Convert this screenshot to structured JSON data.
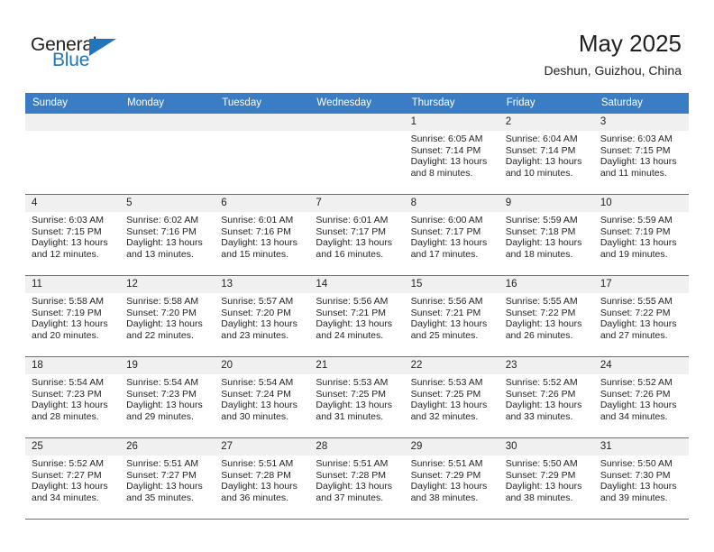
{
  "brand": {
    "name_part1": "General",
    "name_part2": "Blue",
    "accent_color": "#2175bc"
  },
  "header": {
    "month_title": "May 2025",
    "location": "Deshun, Guizhou, China"
  },
  "theme": {
    "header_row_color": "#3b7dc4",
    "daynum_band_color": "#f0f0f0",
    "text_color": "#231f20"
  },
  "weekday_headers": [
    "Sunday",
    "Monday",
    "Tuesday",
    "Wednesday",
    "Thursday",
    "Friday",
    "Saturday"
  ],
  "weeks": [
    [
      {
        "day": "",
        "sunrise": "",
        "sunset": "",
        "daylight_line1": "",
        "daylight_line2": ""
      },
      {
        "day": "",
        "sunrise": "",
        "sunset": "",
        "daylight_line1": "",
        "daylight_line2": ""
      },
      {
        "day": "",
        "sunrise": "",
        "sunset": "",
        "daylight_line1": "",
        "daylight_line2": ""
      },
      {
        "day": "",
        "sunrise": "",
        "sunset": "",
        "daylight_line1": "",
        "daylight_line2": ""
      },
      {
        "day": "1",
        "sunrise": "Sunrise: 6:05 AM",
        "sunset": "Sunset: 7:14 PM",
        "daylight_line1": "Daylight: 13 hours",
        "daylight_line2": "and 8 minutes."
      },
      {
        "day": "2",
        "sunrise": "Sunrise: 6:04 AM",
        "sunset": "Sunset: 7:14 PM",
        "daylight_line1": "Daylight: 13 hours",
        "daylight_line2": "and 10 minutes."
      },
      {
        "day": "3",
        "sunrise": "Sunrise: 6:03 AM",
        "sunset": "Sunset: 7:15 PM",
        "daylight_line1": "Daylight: 13 hours",
        "daylight_line2": "and 11 minutes."
      }
    ],
    [
      {
        "day": "4",
        "sunrise": "Sunrise: 6:03 AM",
        "sunset": "Sunset: 7:15 PM",
        "daylight_line1": "Daylight: 13 hours",
        "daylight_line2": "and 12 minutes."
      },
      {
        "day": "5",
        "sunrise": "Sunrise: 6:02 AM",
        "sunset": "Sunset: 7:16 PM",
        "daylight_line1": "Daylight: 13 hours",
        "daylight_line2": "and 13 minutes."
      },
      {
        "day": "6",
        "sunrise": "Sunrise: 6:01 AM",
        "sunset": "Sunset: 7:16 PM",
        "daylight_line1": "Daylight: 13 hours",
        "daylight_line2": "and 15 minutes."
      },
      {
        "day": "7",
        "sunrise": "Sunrise: 6:01 AM",
        "sunset": "Sunset: 7:17 PM",
        "daylight_line1": "Daylight: 13 hours",
        "daylight_line2": "and 16 minutes."
      },
      {
        "day": "8",
        "sunrise": "Sunrise: 6:00 AM",
        "sunset": "Sunset: 7:17 PM",
        "daylight_line1": "Daylight: 13 hours",
        "daylight_line2": "and 17 minutes."
      },
      {
        "day": "9",
        "sunrise": "Sunrise: 5:59 AM",
        "sunset": "Sunset: 7:18 PM",
        "daylight_line1": "Daylight: 13 hours",
        "daylight_line2": "and 18 minutes."
      },
      {
        "day": "10",
        "sunrise": "Sunrise: 5:59 AM",
        "sunset": "Sunset: 7:19 PM",
        "daylight_line1": "Daylight: 13 hours",
        "daylight_line2": "and 19 minutes."
      }
    ],
    [
      {
        "day": "11",
        "sunrise": "Sunrise: 5:58 AM",
        "sunset": "Sunset: 7:19 PM",
        "daylight_line1": "Daylight: 13 hours",
        "daylight_line2": "and 20 minutes."
      },
      {
        "day": "12",
        "sunrise": "Sunrise: 5:58 AM",
        "sunset": "Sunset: 7:20 PM",
        "daylight_line1": "Daylight: 13 hours",
        "daylight_line2": "and 22 minutes."
      },
      {
        "day": "13",
        "sunrise": "Sunrise: 5:57 AM",
        "sunset": "Sunset: 7:20 PM",
        "daylight_line1": "Daylight: 13 hours",
        "daylight_line2": "and 23 minutes."
      },
      {
        "day": "14",
        "sunrise": "Sunrise: 5:56 AM",
        "sunset": "Sunset: 7:21 PM",
        "daylight_line1": "Daylight: 13 hours",
        "daylight_line2": "and 24 minutes."
      },
      {
        "day": "15",
        "sunrise": "Sunrise: 5:56 AM",
        "sunset": "Sunset: 7:21 PM",
        "daylight_line1": "Daylight: 13 hours",
        "daylight_line2": "and 25 minutes."
      },
      {
        "day": "16",
        "sunrise": "Sunrise: 5:55 AM",
        "sunset": "Sunset: 7:22 PM",
        "daylight_line1": "Daylight: 13 hours",
        "daylight_line2": "and 26 minutes."
      },
      {
        "day": "17",
        "sunrise": "Sunrise: 5:55 AM",
        "sunset": "Sunset: 7:22 PM",
        "daylight_line1": "Daylight: 13 hours",
        "daylight_line2": "and 27 minutes."
      }
    ],
    [
      {
        "day": "18",
        "sunrise": "Sunrise: 5:54 AM",
        "sunset": "Sunset: 7:23 PM",
        "daylight_line1": "Daylight: 13 hours",
        "daylight_line2": "and 28 minutes."
      },
      {
        "day": "19",
        "sunrise": "Sunrise: 5:54 AM",
        "sunset": "Sunset: 7:23 PM",
        "daylight_line1": "Daylight: 13 hours",
        "daylight_line2": "and 29 minutes."
      },
      {
        "day": "20",
        "sunrise": "Sunrise: 5:54 AM",
        "sunset": "Sunset: 7:24 PM",
        "daylight_line1": "Daylight: 13 hours",
        "daylight_line2": "and 30 minutes."
      },
      {
        "day": "21",
        "sunrise": "Sunrise: 5:53 AM",
        "sunset": "Sunset: 7:25 PM",
        "daylight_line1": "Daylight: 13 hours",
        "daylight_line2": "and 31 minutes."
      },
      {
        "day": "22",
        "sunrise": "Sunrise: 5:53 AM",
        "sunset": "Sunset: 7:25 PM",
        "daylight_line1": "Daylight: 13 hours",
        "daylight_line2": "and 32 minutes."
      },
      {
        "day": "23",
        "sunrise": "Sunrise: 5:52 AM",
        "sunset": "Sunset: 7:26 PM",
        "daylight_line1": "Daylight: 13 hours",
        "daylight_line2": "and 33 minutes."
      },
      {
        "day": "24",
        "sunrise": "Sunrise: 5:52 AM",
        "sunset": "Sunset: 7:26 PM",
        "daylight_line1": "Daylight: 13 hours",
        "daylight_line2": "and 34 minutes."
      }
    ],
    [
      {
        "day": "25",
        "sunrise": "Sunrise: 5:52 AM",
        "sunset": "Sunset: 7:27 PM",
        "daylight_line1": "Daylight: 13 hours",
        "daylight_line2": "and 34 minutes."
      },
      {
        "day": "26",
        "sunrise": "Sunrise: 5:51 AM",
        "sunset": "Sunset: 7:27 PM",
        "daylight_line1": "Daylight: 13 hours",
        "daylight_line2": "and 35 minutes."
      },
      {
        "day": "27",
        "sunrise": "Sunrise: 5:51 AM",
        "sunset": "Sunset: 7:28 PM",
        "daylight_line1": "Daylight: 13 hours",
        "daylight_line2": "and 36 minutes."
      },
      {
        "day": "28",
        "sunrise": "Sunrise: 5:51 AM",
        "sunset": "Sunset: 7:28 PM",
        "daylight_line1": "Daylight: 13 hours",
        "daylight_line2": "and 37 minutes."
      },
      {
        "day": "29",
        "sunrise": "Sunrise: 5:51 AM",
        "sunset": "Sunset: 7:29 PM",
        "daylight_line1": "Daylight: 13 hours",
        "daylight_line2": "and 38 minutes."
      },
      {
        "day": "30",
        "sunrise": "Sunrise: 5:50 AM",
        "sunset": "Sunset: 7:29 PM",
        "daylight_line1": "Daylight: 13 hours",
        "daylight_line2": "and 38 minutes."
      },
      {
        "day": "31",
        "sunrise": "Sunrise: 5:50 AM",
        "sunset": "Sunset: 7:30 PM",
        "daylight_line1": "Daylight: 13 hours",
        "daylight_line2": "and 39 minutes."
      }
    ]
  ]
}
